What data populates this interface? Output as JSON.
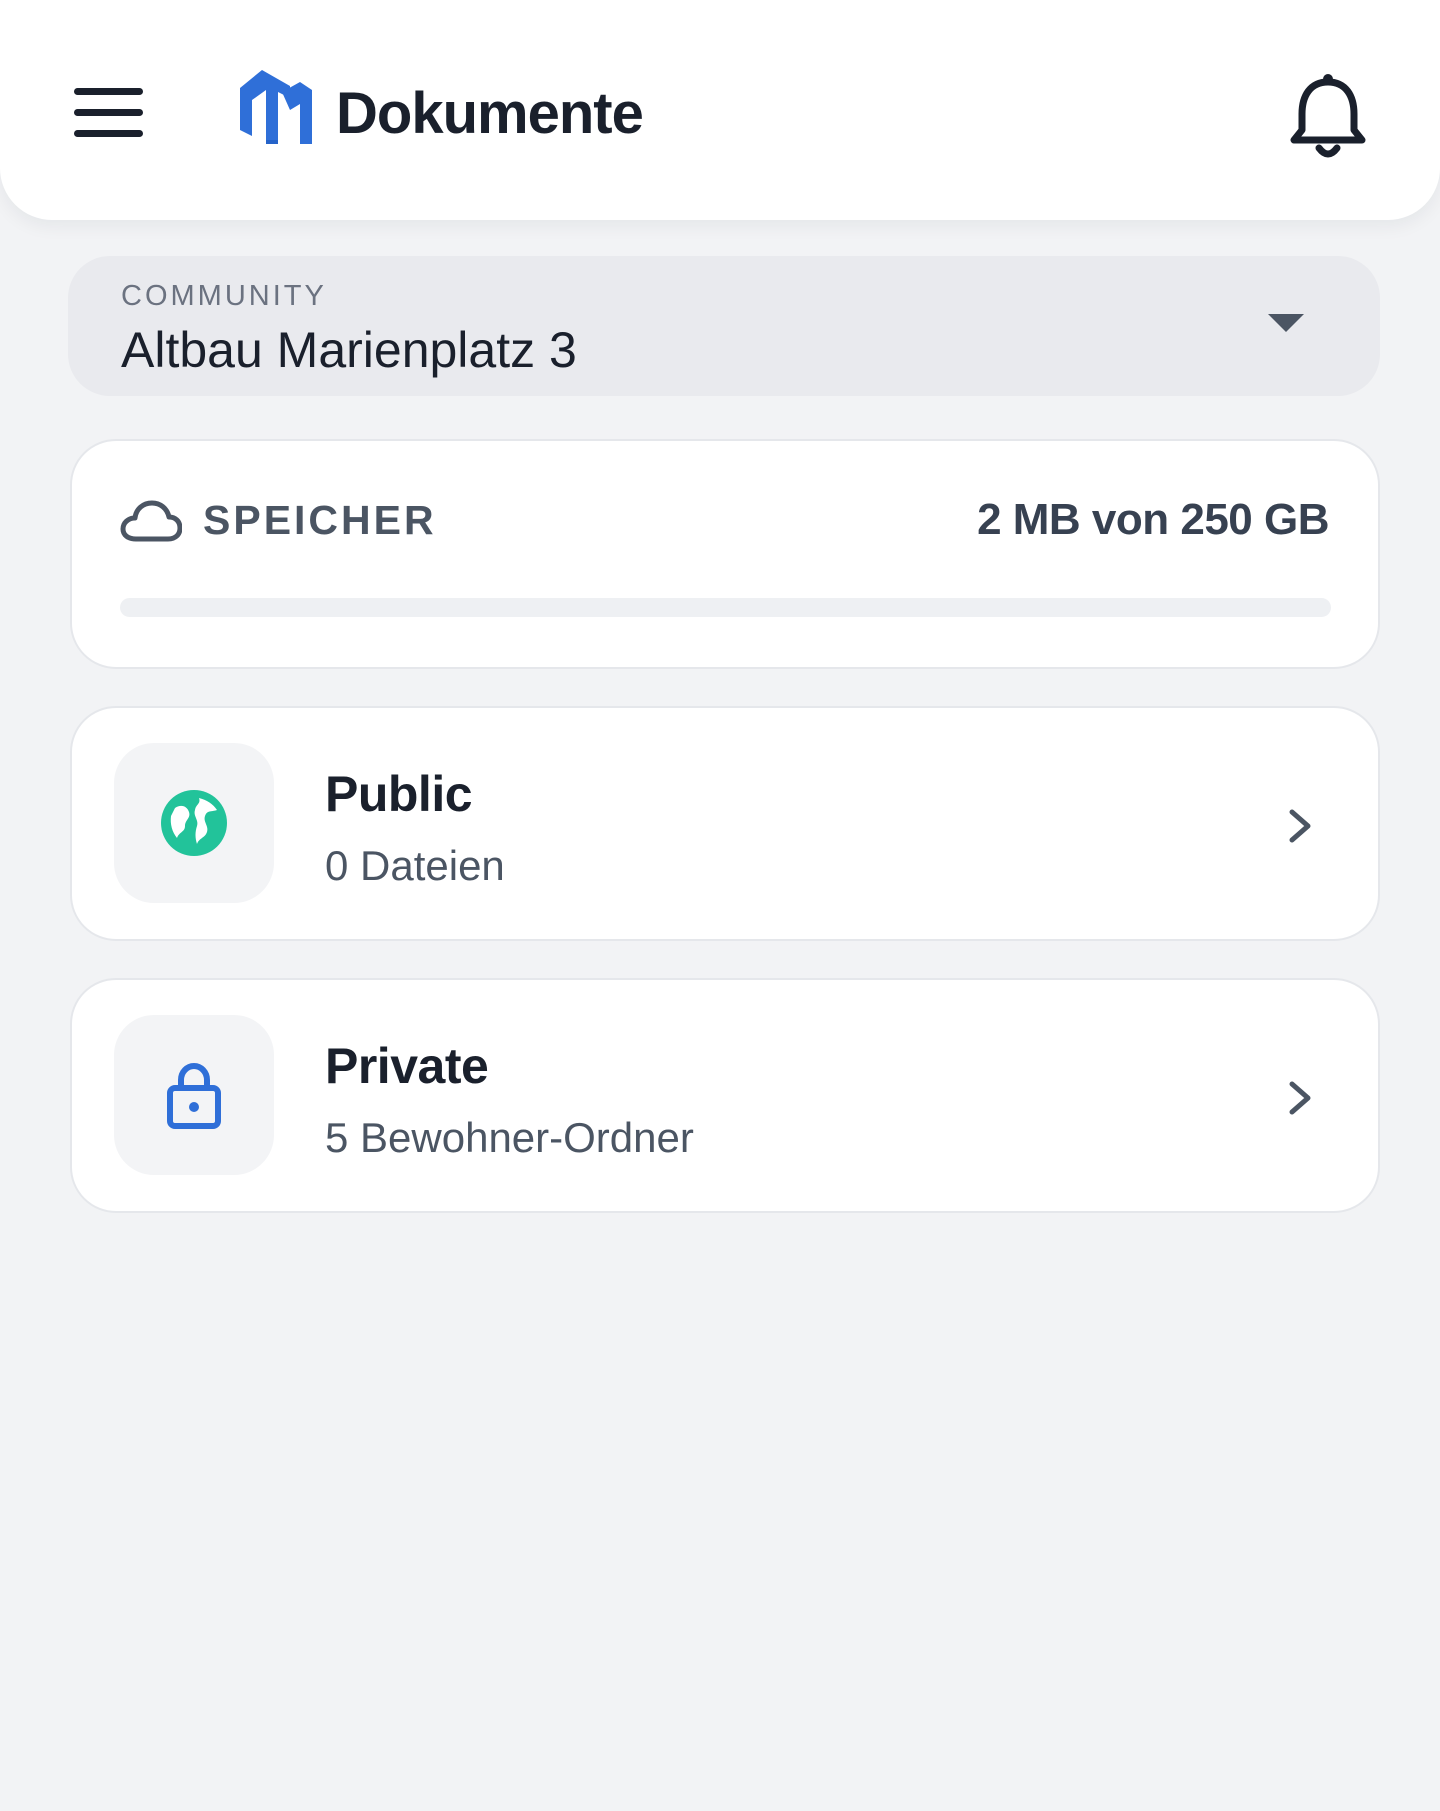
{
  "header": {
    "title": "Dokumente",
    "menu_icon": "hamburger-menu-icon",
    "logo": "brand-logo",
    "notifications_icon": "bell-icon"
  },
  "community": {
    "caption": "COMMUNITY",
    "selected": "Altbau Marienplatz 3"
  },
  "storage": {
    "icon": "cloud-icon",
    "label": "SPEICHER",
    "usage": "2 MB von 250 GB",
    "used_fraction": 0.0
  },
  "folders": [
    {
      "icon": "globe-icon",
      "title": "Public",
      "subtitle": "0 Dateien",
      "icon_color": "#22c39a"
    },
    {
      "icon": "lock-icon",
      "title": "Private",
      "subtitle": "5 Bewohner-Ordner",
      "icon_color": "#2f6fd8"
    }
  ],
  "colors": {
    "brand": "#2f6fd8",
    "text_primary": "#1a202c",
    "text_secondary": "#4b5563",
    "background": "#f2f3f5",
    "surface": "#ffffff"
  }
}
